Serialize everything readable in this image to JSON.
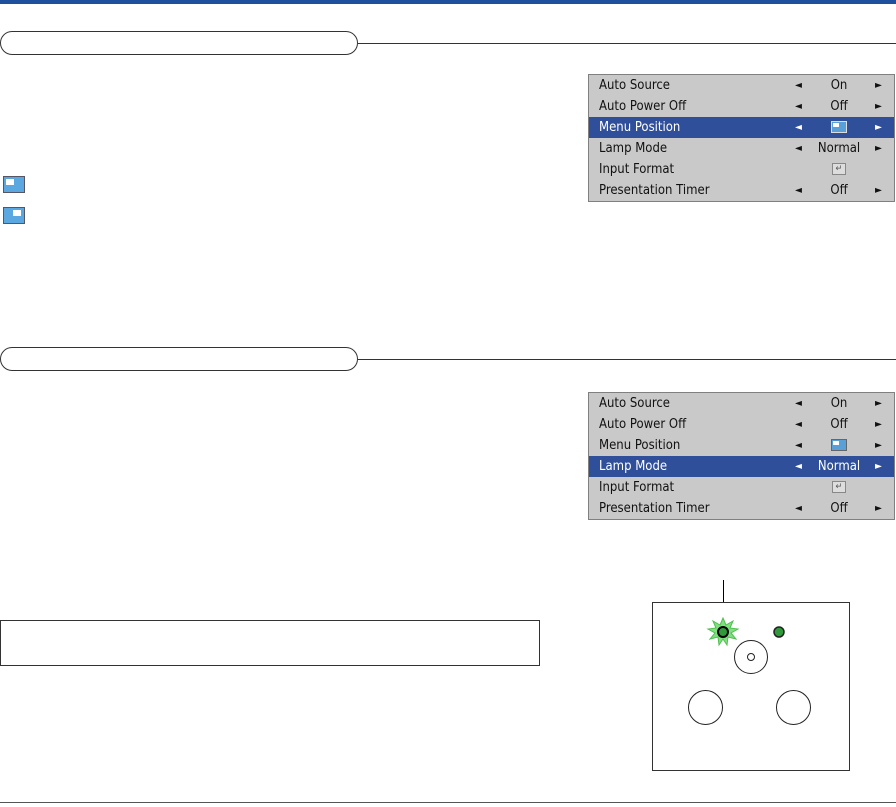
{
  "osd_menu_1": {
    "rows": [
      {
        "label": "Auto Source",
        "value": "On",
        "has_arrows": true,
        "type": "text"
      },
      {
        "label": "Auto Power Off",
        "value": "Off",
        "has_arrows": true,
        "type": "text"
      },
      {
        "label": "Menu Position",
        "value": "",
        "has_arrows": true,
        "type": "position-icon",
        "highlighted": true
      },
      {
        "label": "Lamp Mode",
        "value": "Normal",
        "has_arrows": true,
        "type": "text"
      },
      {
        "label": "Input Format",
        "value": "",
        "has_arrows": false,
        "type": "enter-icon"
      },
      {
        "label": "Presentation Timer",
        "value": "Off",
        "has_arrows": true,
        "type": "text"
      }
    ]
  },
  "osd_menu_2": {
    "rows": [
      {
        "label": "Auto Source",
        "value": "On",
        "has_arrows": true,
        "type": "text"
      },
      {
        "label": "Auto Power Off",
        "value": "Off",
        "has_arrows": true,
        "type": "text"
      },
      {
        "label": "Menu Position",
        "value": "",
        "has_arrows": true,
        "type": "position-icon"
      },
      {
        "label": "Lamp Mode",
        "value": "Normal",
        "has_arrows": true,
        "type": "text",
        "highlighted": true
      },
      {
        "label": "Input Format",
        "value": "",
        "has_arrows": false,
        "type": "enter-icon"
      },
      {
        "label": "Presentation Timer",
        "value": "Off",
        "has_arrows": true,
        "type": "text"
      }
    ]
  },
  "arrows": {
    "left": "◄",
    "right": "►"
  },
  "icons": {
    "enter": "↵"
  },
  "colors": {
    "accent": "#1e4f9c",
    "highlight_row": "#2f4f9a",
    "osd_background": "#c9c9c9",
    "menu_position_icon": "#5ba8e0",
    "lamp_indicator_glow": "#7ee07e",
    "led_green": "#2e9a3a"
  }
}
